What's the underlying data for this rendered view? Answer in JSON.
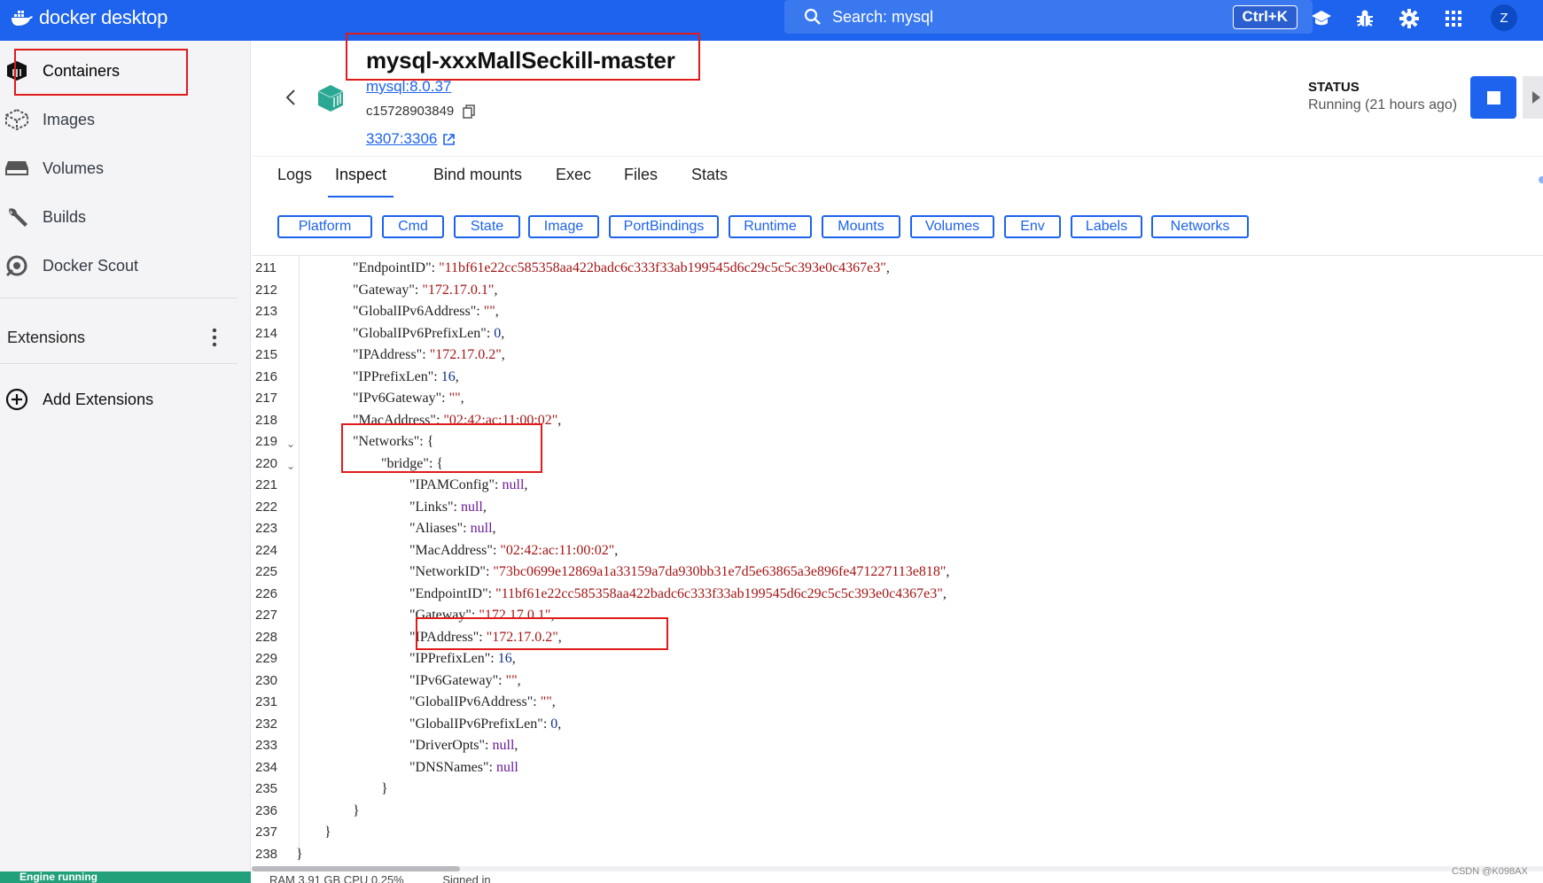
{
  "topbar": {
    "logo_text": "docker desktop",
    "search_text": "Search: mysql",
    "shortcut": "Ctrl+K",
    "avatar_initial": "Z",
    "icons": [
      "learning-center-icon",
      "bug-icon",
      "settings-icon",
      "grid-icon"
    ]
  },
  "sidebar": {
    "items": [
      {
        "label": "Containers",
        "icon": "container-icon",
        "active": true
      },
      {
        "label": "Images",
        "icon": "images-icon"
      },
      {
        "label": "Volumes",
        "icon": "volumes-icon"
      },
      {
        "label": "Builds",
        "icon": "wrench-icon"
      },
      {
        "label": "Docker Scout",
        "icon": "scout-icon"
      }
    ],
    "extensions_title": "Extensions",
    "add_extensions": "Add Extensions",
    "engine_status": "Engine running"
  },
  "container": {
    "name": "mysql-xxxMallSeckill-master",
    "image": "mysql:8.0.37",
    "id": "c15728903849",
    "port": "3307:3306",
    "status_label": "STATUS",
    "status_value": "Running (21 hours ago)"
  },
  "tabs": [
    {
      "label": "Logs"
    },
    {
      "label": "Inspect",
      "active": true
    },
    {
      "label": "Bind mounts"
    },
    {
      "label": "Exec"
    },
    {
      "label": "Files"
    },
    {
      "label": "Stats"
    }
  ],
  "filters": [
    "Platform",
    "Cmd",
    "State",
    "Image",
    "PortBindings",
    "Runtime",
    "Mounts",
    "Volumes",
    "Env",
    "Labels",
    "Networks"
  ],
  "code_lines": [
    {
      "n": "211",
      "indent": 2,
      "key": "EndpointID",
      "val": "\"11bf61e22cc585358aa422badc6c333f33ab199545d6c29c5c5c393e0c4367e3\"",
      "type": "s",
      "comma": true
    },
    {
      "n": "212",
      "indent": 2,
      "key": "Gateway",
      "val": "\"172.17.0.1\"",
      "type": "s",
      "comma": true
    },
    {
      "n": "213",
      "indent": 2,
      "key": "GlobalIPv6Address",
      "val": "\"\"",
      "type": "s",
      "comma": true
    },
    {
      "n": "214",
      "indent": 2,
      "key": "GlobalIPv6PrefixLen",
      "val": "0",
      "type": "n",
      "comma": true
    },
    {
      "n": "215",
      "indent": 2,
      "key": "IPAddress",
      "val": "\"172.17.0.2\"",
      "type": "s",
      "comma": true
    },
    {
      "n": "216",
      "indent": 2,
      "key": "IPPrefixLen",
      "val": "16",
      "type": "n",
      "comma": true
    },
    {
      "n": "217",
      "indent": 2,
      "key": "IPv6Gateway",
      "val": "\"\"",
      "type": "s",
      "comma": true
    },
    {
      "n": "218",
      "indent": 2,
      "key": "MacAddress",
      "val": "\"02:42:ac:11:00:02\"",
      "type": "s",
      "comma": true
    },
    {
      "n": "219",
      "indent": 2,
      "key": "Networks",
      "val": "{",
      "type": "k",
      "comma": false,
      "fold": true
    },
    {
      "n": "220",
      "indent": 3,
      "key": "bridge",
      "val": "{",
      "type": "k",
      "comma": false,
      "fold": true
    },
    {
      "n": "221",
      "indent": 4,
      "key": "IPAMConfig",
      "val": "null",
      "type": "nl",
      "comma": true
    },
    {
      "n": "222",
      "indent": 4,
      "key": "Links",
      "val": "null",
      "type": "nl",
      "comma": true
    },
    {
      "n": "223",
      "indent": 4,
      "key": "Aliases",
      "val": "null",
      "type": "nl",
      "comma": true
    },
    {
      "n": "224",
      "indent": 4,
      "key": "MacAddress",
      "val": "\"02:42:ac:11:00:02\"",
      "type": "s",
      "comma": true
    },
    {
      "n": "225",
      "indent": 4,
      "key": "NetworkID",
      "val": "\"73bc0699e12869a1a33159a7da930bb31e7d5e63865a3e896fe471227113e818\"",
      "type": "s",
      "comma": true
    },
    {
      "n": "226",
      "indent": 4,
      "key": "EndpointID",
      "val": "\"11bf61e22cc585358aa422badc6c333f33ab199545d6c29c5c5c393e0c4367e3\"",
      "type": "s",
      "comma": true
    },
    {
      "n": "227",
      "indent": 4,
      "key": "Gateway",
      "val": "\"172.17.0.1\"",
      "type": "s",
      "comma": true
    },
    {
      "n": "228",
      "indent": 4,
      "key": "IPAddress",
      "val": "\"172.17.0.2\"",
      "type": "s",
      "comma": true
    },
    {
      "n": "229",
      "indent": 4,
      "key": "IPPrefixLen",
      "val": "16",
      "type": "n",
      "comma": true
    },
    {
      "n": "230",
      "indent": 4,
      "key": "IPv6Gateway",
      "val": "\"\"",
      "type": "s",
      "comma": true
    },
    {
      "n": "231",
      "indent": 4,
      "key": "GlobalIPv6Address",
      "val": "\"\"",
      "type": "s",
      "comma": true
    },
    {
      "n": "232",
      "indent": 4,
      "key": "GlobalIPv6PrefixLen",
      "val": "0",
      "type": "n",
      "comma": true
    },
    {
      "n": "233",
      "indent": 4,
      "key": "DriverOpts",
      "val": "null",
      "type": "nl",
      "comma": true
    },
    {
      "n": "234",
      "indent": 4,
      "key": "DNSNames",
      "val": "null",
      "type": "nl",
      "comma": false
    },
    {
      "n": "235",
      "indent": 3,
      "raw": "}"
    },
    {
      "n": "236",
      "indent": 2,
      "raw": "}"
    },
    {
      "n": "237",
      "indent": 1,
      "raw": "}"
    },
    {
      "n": "238",
      "indent": 0,
      "raw": "}"
    }
  ],
  "footer": {
    "stats": "RAM 3.91 GB   CPU 0.25%",
    "signed_in": "Signed in"
  },
  "watermark": "CSDN @K098AX",
  "colors": {
    "brand": "#1d63ed",
    "string": "#a31515",
    "annotation": "#e11a1a",
    "engine_green": "#22a07a"
  }
}
